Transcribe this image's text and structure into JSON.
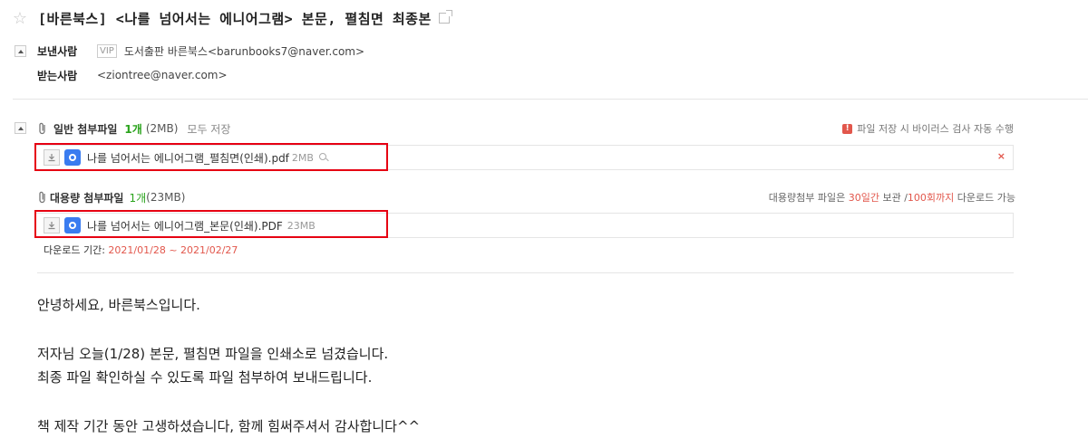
{
  "subject": "[바른북스] <나를 넘어서는 에니어그램> 본문, 펼침면 최종본",
  "sender": {
    "label": "보낸사람",
    "vip": "VIP",
    "address": "도서출판 바른북스<barunbooks7@naver.com>"
  },
  "receiver": {
    "label": "받는사람",
    "address": "<ziontree@naver.com>"
  },
  "general_attachments": {
    "title": "일반 첨부파일",
    "count": "1개",
    "size": "(2MB)",
    "save_all": "모두 저장",
    "virus_note": "파일 저장 시 바이러스 검사 자동 수행",
    "files": [
      {
        "name": "나를 넘어서는 에니어그램_펼침면(인쇄).pdf",
        "size": "2MB"
      }
    ]
  },
  "large_attachments": {
    "title": "대용량 첨부파일",
    "count": "1개",
    "size": "(23MB)",
    "note_prefix": "대용량첨부 파일은 ",
    "note_days": "30일간",
    "note_mid": " 보관 /",
    "note_times": "100회까지",
    "note_suffix": " 다운로드 가능",
    "files": [
      {
        "name": "나를 넘어서는 에니어그램_본문(인쇄).PDF",
        "size": "23MB"
      }
    ],
    "period_label": "다운로드 기간: ",
    "period_dates": "2021/01/28 ~ 2021/02/27"
  },
  "body": {
    "lines": [
      "안녕하세요, 바른북스입니다.",
      "저자님 오늘(1/28) 본문, 펼침면 파일을 인쇄소로 넘겼습니다.",
      "최종 파일 확인하실 수 있도록 파일 첨부하여 보내드립니다.",
      "책 제작 기간 동안 고생하셨습니다, 함께 힘써주셔서 감사합니다^^"
    ]
  },
  "colors": {
    "accent_green": "#2aa31c",
    "alert_red": "#e2574c",
    "highlight_frame": "#e60012"
  }
}
